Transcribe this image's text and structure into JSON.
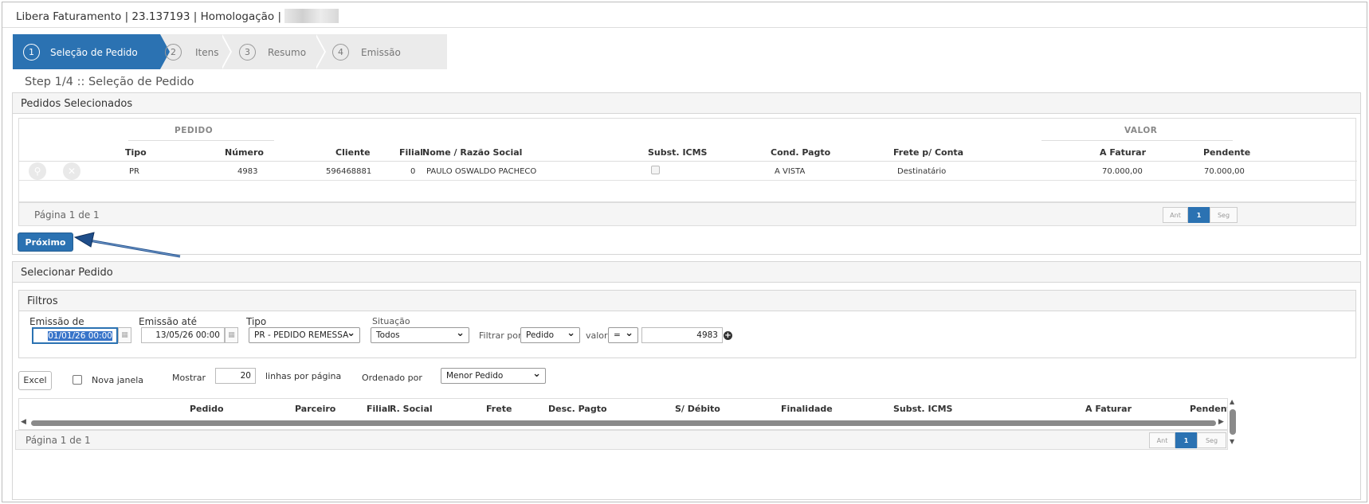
{
  "window": {
    "title": "Libera Faturamento | 23.137193 | Homologação |"
  },
  "wizard": {
    "steps": [
      {
        "num": "1",
        "label": "Seleção de Pedido"
      },
      {
        "num": "2",
        "label": "Itens"
      },
      {
        "num": "3",
        "label": "Resumo"
      },
      {
        "num": "4",
        "label": "Emissão"
      }
    ],
    "heading": "Step 1/4 :: Seleção de Pedido"
  },
  "selected": {
    "panel_title": "Pedidos Selecionados",
    "group_pedido": "PEDIDO",
    "group_valor": "VALOR",
    "columns": {
      "tipo": "Tipo",
      "numero": "Número",
      "cliente": "Cliente",
      "filial": "Filial",
      "nome": "Nome / Razão Social",
      "subst": "Subst. ICMS",
      "cond": "Cond. Pagto",
      "frete": "Frete p/ Conta",
      "afaturar": "A Faturar",
      "pendente": "Pendente"
    },
    "rows": [
      {
        "tipo": "PR",
        "numero": "4983",
        "cliente": "596468881",
        "filial": "0",
        "nome": "PAULO OSWALDO PACHECO",
        "cond": "A VISTA",
        "frete": "Destinatário",
        "afaturar": "70.000,00",
        "pendente": "70.000,00"
      }
    ],
    "pager": {
      "text": "Página 1 de 1",
      "prev": "Ant",
      "current": "1",
      "next": "Seg"
    }
  },
  "actions": {
    "next_label": "Próximo"
  },
  "select": {
    "panel_title": "Selecionar Pedido",
    "filters": {
      "title": "Filtros",
      "emissao_de_label": "Emissão de",
      "emissao_de_value": "01/01/26 00:00",
      "emissao_ate_label": "Emissão até",
      "emissao_ate_value": "13/05/26 00:00",
      "tipo_label": "Tipo",
      "tipo_value": "PR - PEDIDO REMESSA",
      "situacao_label": "Situação",
      "situacao_value": "Todos",
      "filtrar_label": "Filtrar por",
      "filtrar_value": "Pedido",
      "valor_label": "valor",
      "op_value": "=",
      "valor_value": "4983"
    },
    "toolbar": {
      "excel": "Excel",
      "nova_janela": "Nova janela",
      "mostrar": "Mostrar",
      "linhas_value": "20",
      "linhas_label": "linhas por página",
      "ordenado_label": "Ordenado por",
      "ordenado_value": "Menor Pedido"
    },
    "columns": {
      "pedido": "Pedido",
      "parceiro": "Parceiro",
      "filial": "Filial",
      "rsocial": "R. Social",
      "frete": "Frete",
      "desc": "Desc. Pagto",
      "sdebito": "S/ Débito",
      "finalidade": "Finalidade",
      "subst": "Subst. ICMS",
      "afaturar": "A Faturar",
      "pendente": "Pendente"
    },
    "pager": {
      "text": "Página 1 de 1",
      "prev": "Ant",
      "current": "1",
      "next": "Seg"
    }
  },
  "colors": {
    "primary": "#2b72b2",
    "arrow": "#1f4e8a"
  }
}
